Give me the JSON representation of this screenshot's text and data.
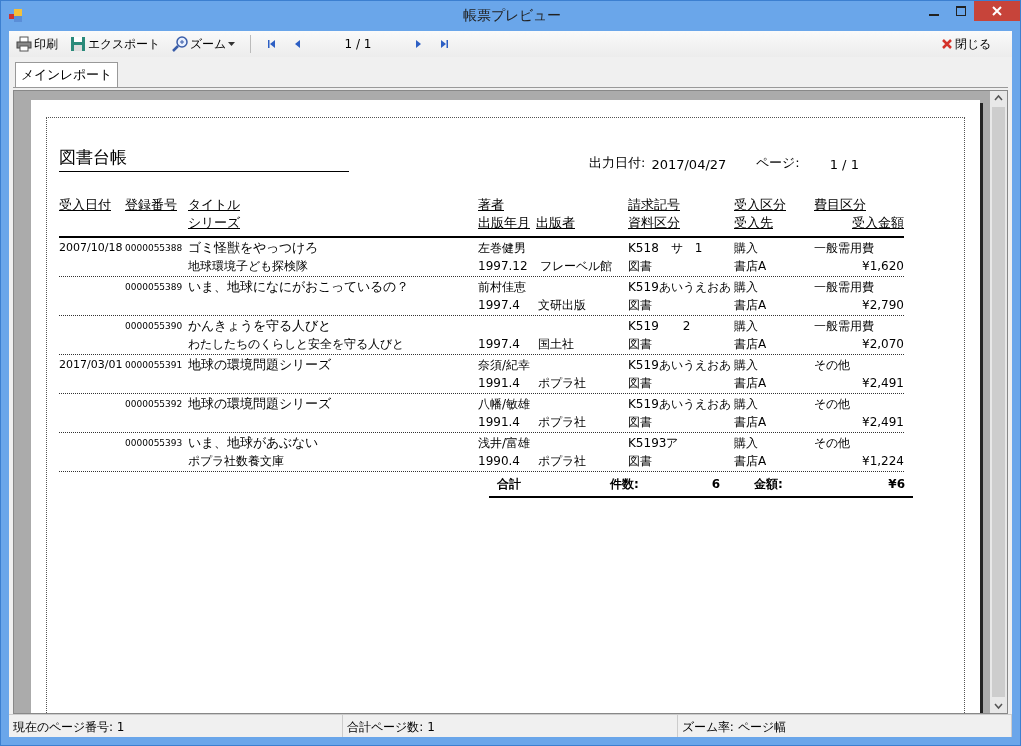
{
  "window": {
    "title": "帳票プレビュー"
  },
  "toolbar": {
    "items": [
      {
        "label": "印刷",
        "kind": "print"
      },
      {
        "label": "エクスポート",
        "kind": "export"
      },
      {
        "label": "ズーム",
        "kind": "zoom"
      }
    ],
    "page": "1 / 1",
    "close": "閉じる"
  },
  "tabs": [
    {
      "label": "メインレポート",
      "selected": true
    }
  ],
  "report": {
    "title": "図書台帳",
    "output_date_label": "出力日付:",
    "output_date": "2017/04/27",
    "page_label": "ページ:",
    "page_value": "1 / 1",
    "headers": {
      "date": "受入日付",
      "reg_no": "登録番号",
      "title": "タイトル",
      "series": "シリーズ",
      "author": "著者",
      "pub_date": "出版年月",
      "publisher": "出版者",
      "call_no": "請求記号",
      "material": "資料区分",
      "acq_type": "受入区分",
      "supplier": "受入先",
      "expense": "費目区分",
      "amount": "受入金額"
    },
    "rows": [
      {
        "date": "2007/10/18",
        "reg_no": "0000055388",
        "title": "ゴミ怪獣をやっつけろ",
        "series": "地球環境子ども探検隊",
        "author": "左巻健男",
        "pub_date": "1997.12",
        "publisher": "フレーベル館",
        "call_no": "K518　サ　1",
        "material": "図書",
        "acq_type": "購入",
        "supplier": "書店A",
        "expense": "一般需用費",
        "amount": "¥1,620"
      },
      {
        "reg_no": "0000055389",
        "title": "いま、地球になにがおこっているの？",
        "author": "前村佳恵",
        "pub_date": "1997.4",
        "publisher": "文研出版",
        "call_no": "K519あいうえおあ",
        "material": "図書",
        "acq_type": "購入",
        "supplier": "書店A",
        "expense": "一般需用費",
        "amount": "¥2,790"
      },
      {
        "reg_no": "0000055390",
        "title": "かんきょうを守る人びと",
        "series": "わたしたちのくらしと安全を守る人びと",
        "pub_date": "1997.4",
        "publisher": "国土社",
        "call_no": "K519　　2",
        "material": "図書",
        "acq_type": "購入",
        "supplier": "書店A",
        "expense": "一般需用費",
        "amount": "¥2,070"
      },
      {
        "date": "2017/03/01",
        "reg_no": "0000055391",
        "title": "地球の環境問題シリーズ",
        "author": "奈須/紀幸",
        "pub_date": "1991.4",
        "publisher": "ポプラ社",
        "call_no": "K519あいうえおあ",
        "material": "図書",
        "acq_type": "購入",
        "supplier": "書店A",
        "expense": "その他",
        "amount": "¥2,491"
      },
      {
        "reg_no": "0000055392",
        "title": "地球の環境問題シリーズ",
        "author": "八幡/敏雄",
        "pub_date": "1991.4",
        "publisher": "ポプラ社",
        "call_no": "K519あいうえおあ",
        "material": "図書",
        "acq_type": "購入",
        "supplier": "書店A",
        "expense": "その他",
        "amount": "¥2,491"
      },
      {
        "reg_no": "0000055393",
        "title": "いま、地球があぶない",
        "series": "ポプラ社数養文庫",
        "author": "浅井/富雄",
        "pub_date": "1990.4",
        "publisher": "ポプラ社",
        "call_no": "K5193ア",
        "material": "図書",
        "acq_type": "購入",
        "supplier": "書店A",
        "expense": "その他",
        "amount": "¥1,224"
      }
    ],
    "summary": {
      "label": "合計",
      "count_label": "件数:",
      "count": "6",
      "amount_label": "金額:",
      "amount": "¥6"
    }
  },
  "status_bar": [
    "現在のページ番号: 1",
    "合計ページ数: 1",
    "ズーム率: ページ幅"
  ]
}
